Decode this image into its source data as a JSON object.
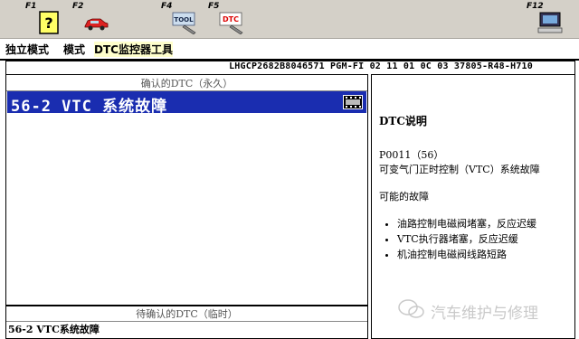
{
  "toolbar": {
    "keys": [
      {
        "label": "F1",
        "icon": "help-icon"
      },
      {
        "label": "F2",
        "icon": "car-icon"
      },
      {
        "label": "F4",
        "icon": "tool-icon"
      },
      {
        "label": "F5",
        "icon": "dtc-icon"
      },
      {
        "label": "F12",
        "icon": "computer-icon"
      }
    ],
    "tool_icon_text": "TOOL",
    "dtc_icon_text": "DTC"
  },
  "menu": {
    "items": [
      "独立模式",
      "模式",
      "DTC监控器工具"
    ]
  },
  "vehicle": {
    "info": "LHGCP2682B8046571  PGM-FI  02 11 01 0C 03  37805-R48-H710"
  },
  "confirmed": {
    "caption": "确认的DTC（永久）",
    "rows": [
      "56-2 VTC 系统故障"
    ]
  },
  "pending": {
    "caption": "待确认的DTC（临时）",
    "rows": [
      "56-2  VTC系统故障"
    ]
  },
  "details": {
    "title": "DTC说明",
    "code": "P0011（56）",
    "description": "可变气门正时控制（VTC）系统故障",
    "causes_heading": "可能的故障",
    "causes": [
      "油路控制电磁阀堵塞，反应迟缓",
      "VTC执行器堵塞，反应迟缓",
      "机油控制电磁阀线路短路"
    ]
  },
  "watermark": "汽车维护与修理",
  "colors": {
    "selection": "#1a2db0",
    "toolbar": "#d4d0c8"
  }
}
